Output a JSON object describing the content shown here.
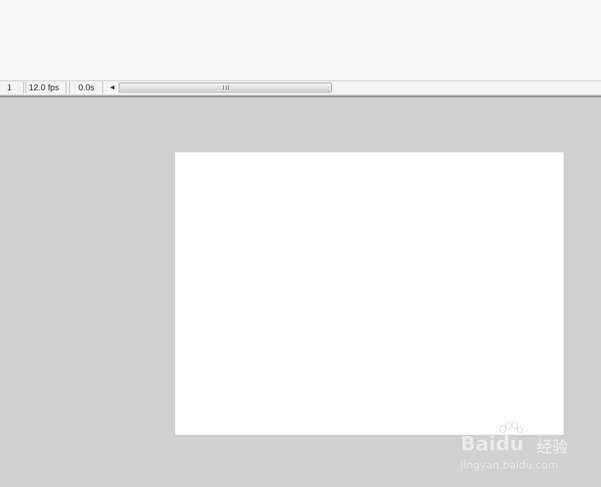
{
  "status_bar": {
    "current_frame": "1",
    "frame_rate": "12.0 fps",
    "elapsed_time": "0.0s"
  },
  "scrollbar": {
    "left_arrow_icon": "triangle-left-icon",
    "grip_icon": "grip-lines-icon"
  },
  "watermark": {
    "logo_text": "Bai",
    "logo_suffix": "du",
    "brand_cn": "经验",
    "url": "jingyan.baidu.com"
  },
  "colors": {
    "pasteboard": "#d1d1d1",
    "stage": "#ffffff",
    "timeline_bg": "#f6f6f6"
  }
}
